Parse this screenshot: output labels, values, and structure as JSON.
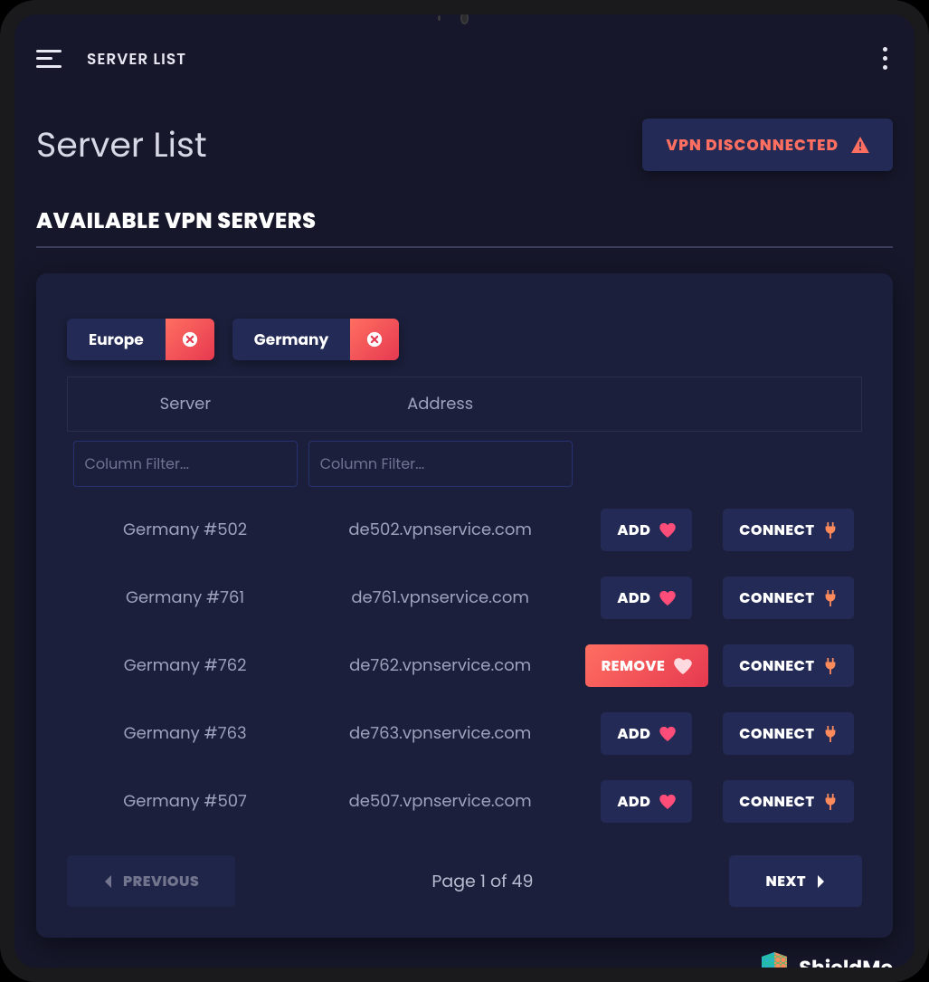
{
  "topbar": {
    "title": "SERVER LIST"
  },
  "page": {
    "title": "Server List",
    "section_title": "AVAILABLE VPN SERVERS"
  },
  "status": {
    "text": "VPN DISCONNECTED"
  },
  "filters": {
    "chips": [
      {
        "label": "Europe"
      },
      {
        "label": "Germany"
      }
    ],
    "placeholder": "Column Filter..."
  },
  "table": {
    "headers": [
      "Server",
      "Address"
    ],
    "rows": [
      {
        "server": "Germany #502",
        "address": "de502.vpnservice.com",
        "fav": false
      },
      {
        "server": "Germany #761",
        "address": "de761.vpnservice.com",
        "fav": false
      },
      {
        "server": "Germany #762",
        "address": "de762.vpnservice.com",
        "fav": true
      },
      {
        "server": "Germany #763",
        "address": "de763.vpnservice.com",
        "fav": false
      },
      {
        "server": "Germany #507",
        "address": "de507.vpnservice.com",
        "fav": false
      }
    ]
  },
  "labels": {
    "add": "ADD",
    "remove": "REMOVE",
    "connect": "CONNECT",
    "previous": "PREVIOUS",
    "next": "NEXT"
  },
  "pagination": {
    "current": 1,
    "total": 49,
    "text": "Page 1 of 49"
  },
  "brand": {
    "name": "ShieldMe"
  }
}
